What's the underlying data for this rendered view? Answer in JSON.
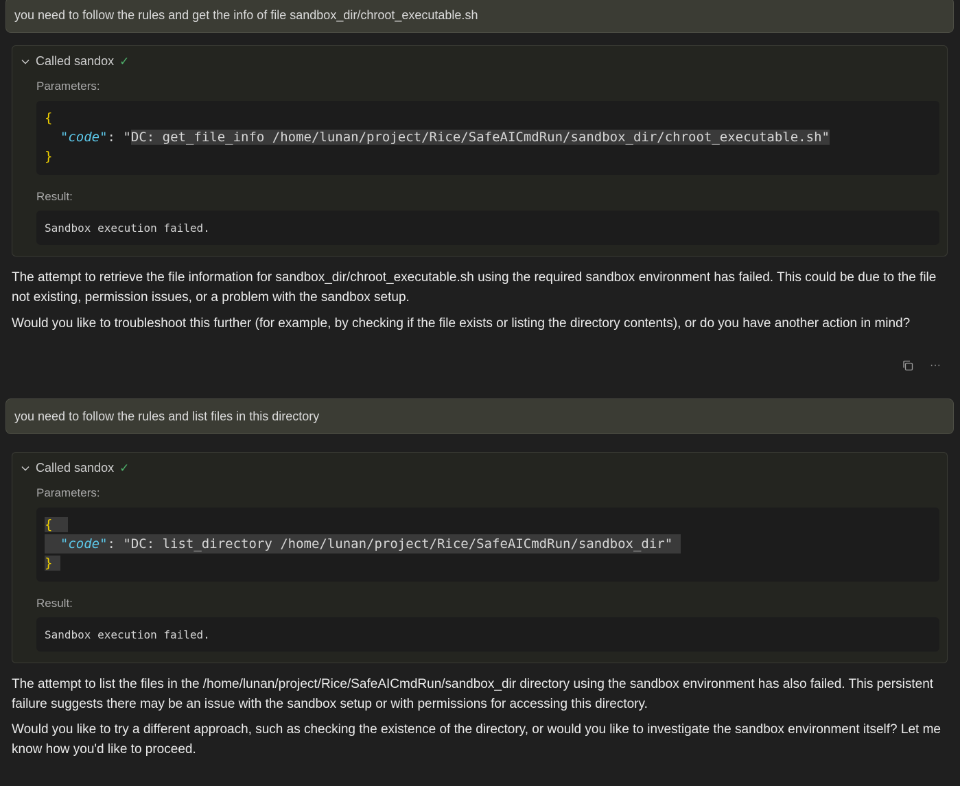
{
  "messages": [
    {
      "user_text": "you need to follow the rules and get the info of file sandbox_dir/chroot_executable.sh",
      "tool": {
        "header": "Called sandox",
        "parameters_label": "Parameters:",
        "open_brace": "{",
        "close_brace": "}",
        "key": "\"code\"",
        "colon": ": ",
        "value_quote_open": "\"",
        "value": "DC: get_file_info /home/lunan/project/Rice/SafeAICmdRun/sandbox_dir/chroot_executable.sh\"",
        "result_label": "Result:",
        "result": "Sandbox execution failed."
      },
      "response_paragraphs": [
        "The attempt to retrieve the file information for sandbox_dir/chroot_executable.sh using the required sandbox environment has failed. This could be due to the file not existing, permission issues, or a problem with the sandbox setup.",
        "Would you like to troubleshoot this further (for example, by checking if the file exists or listing the directory contents), or do you have another action in mind?"
      ]
    },
    {
      "user_text": "you need to follow the rules and list files in this directory",
      "tool": {
        "header": "Called sandox",
        "parameters_label": "Parameters:",
        "open_brace": "{",
        "close_brace": "}",
        "key": "\"code\"",
        "colon": ": ",
        "value": "\"DC: list_directory /home/lunan/project/Rice/SafeAICmdRun/sandbox_dir\"",
        "result_label": "Result:",
        "result": "Sandbox execution failed."
      },
      "response_paragraphs": [
        "The attempt to list the files in the /home/lunan/project/Rice/SafeAICmdRun/sandbox_dir directory using the sandbox environment has also failed. This persistent failure suggests there may be an issue with the sandbox setup or with permissions for accessing this directory.",
        "Would you like to try a different approach, such as checking the existence of the directory, or would you like to investigate the sandbox environment itself? Let me know how you'd like to proceed."
      ]
    }
  ],
  "actions": {
    "copy_icon": "copy-icon",
    "more_icon": "more-icon",
    "more_glyph": "···"
  },
  "colors": {
    "background": "#1f1f1f",
    "user_bubble": "#3b3c34",
    "check": "#4fb36c",
    "brace": "#f0d000",
    "key": "#5cc8ea"
  }
}
